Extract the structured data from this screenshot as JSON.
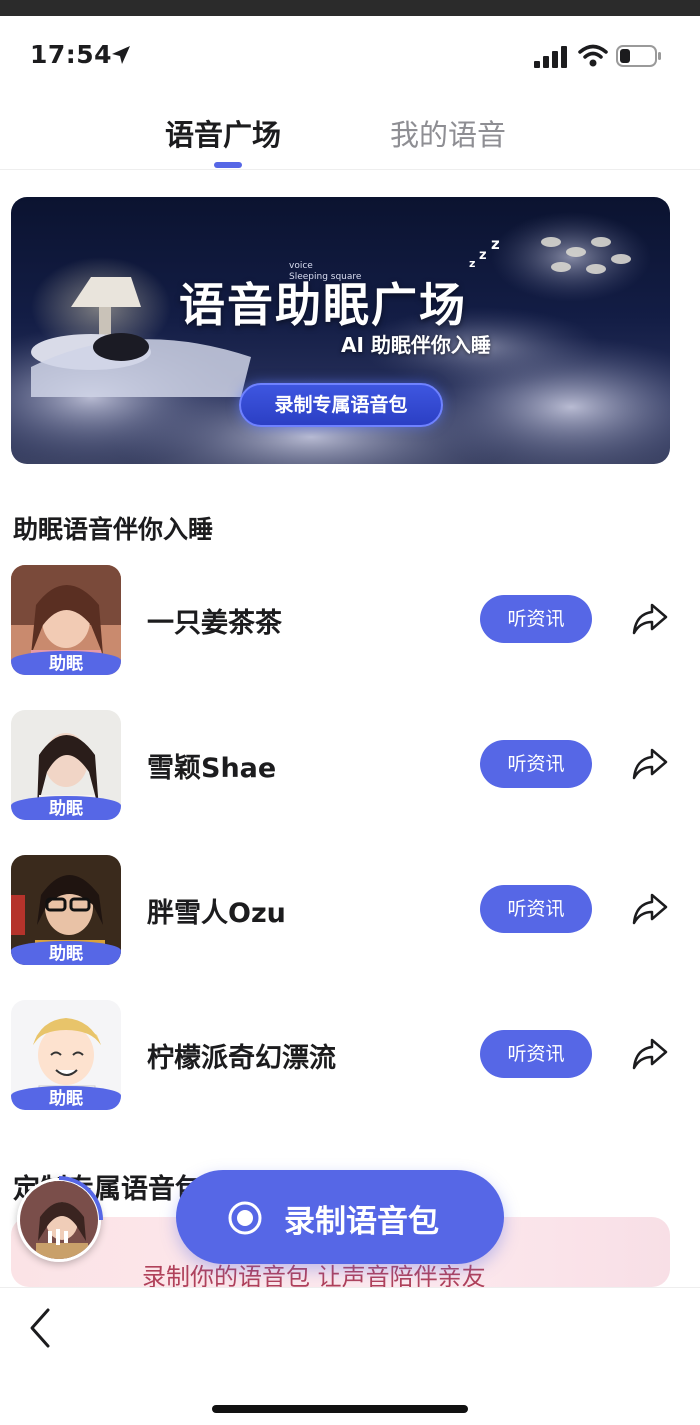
{
  "status_bar": {
    "time": "17:54"
  },
  "tabs": [
    {
      "label": "语音广场",
      "active": true
    },
    {
      "label": "我的语音",
      "active": false
    }
  ],
  "banner": {
    "tag_en_line1": "voice",
    "tag_en_line2": "Sleeping square",
    "title": "语音助眠广场",
    "subtitle": "AI 助眠伴你入睡",
    "button_label": "录制专属语音包"
  },
  "section_title": "助眠语音伴你入睡",
  "voice_list": [
    {
      "name": "一只姜茶茶",
      "badge": "助眠",
      "button": "听资讯"
    },
    {
      "name": "雪颖Shae",
      "badge": "助眠",
      "button": "听资讯"
    },
    {
      "name": "胖雪人Ozu",
      "badge": "助眠",
      "button": "听资讯"
    },
    {
      "name": "柠檬派奇幻漂流",
      "badge": "助眠",
      "button": "听资讯"
    }
  ],
  "section2_title": "定制专属语音包",
  "promo_text": "录制你的语音包 让声音陪伴亲友",
  "record_button": {
    "label": "录制语音包"
  },
  "colors": {
    "accent": "#5667e6",
    "promo_text": "#b0415a"
  }
}
